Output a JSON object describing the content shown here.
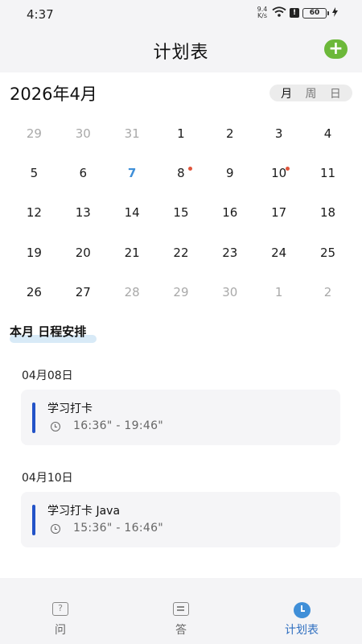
{
  "status_bar": {
    "time": "4:37",
    "net_speed_value": "9.4",
    "net_speed_unit": "K/s",
    "battery": "60"
  },
  "header": {
    "title": "计划表",
    "add_icon": "plus-circle-icon"
  },
  "calendar": {
    "month_title": "2026年4月",
    "view_options": [
      "月",
      "周",
      "日"
    ],
    "selected_view": "月",
    "today_day": "7",
    "event_marker_days": [
      "8",
      "10"
    ],
    "weeks": [
      [
        {
          "d": "29",
          "m": true
        },
        {
          "d": "30",
          "m": true
        },
        {
          "d": "31",
          "m": true
        },
        {
          "d": "1"
        },
        {
          "d": "2"
        },
        {
          "d": "3"
        },
        {
          "d": "4"
        }
      ],
      [
        {
          "d": "5"
        },
        {
          "d": "6"
        },
        {
          "d": "7",
          "today": true
        },
        {
          "d": "8",
          "dot": true
        },
        {
          "d": "9"
        },
        {
          "d": "10",
          "dot": true
        },
        {
          "d": "11"
        }
      ],
      [
        {
          "d": "12"
        },
        {
          "d": "13"
        },
        {
          "d": "14"
        },
        {
          "d": "15"
        },
        {
          "d": "16"
        },
        {
          "d": "17"
        },
        {
          "d": "18"
        }
      ],
      [
        {
          "d": "19"
        },
        {
          "d": "20"
        },
        {
          "d": "21"
        },
        {
          "d": "22"
        },
        {
          "d": "23"
        },
        {
          "d": "24"
        },
        {
          "d": "25"
        }
      ],
      [
        {
          "d": "26"
        },
        {
          "d": "27"
        },
        {
          "d": "28",
          "m": true
        },
        {
          "d": "29",
          "m": true
        },
        {
          "d": "30",
          "m": true
        },
        {
          "d": "1",
          "m": true
        },
        {
          "d": "2",
          "m": true
        }
      ]
    ]
  },
  "schedule": {
    "section_title": "本月 日程安排",
    "groups": [
      {
        "date": "04月08日",
        "events": [
          {
            "title": "学习打卡",
            "time": "16:36\" - 19:46\""
          }
        ]
      },
      {
        "date": "04月10日",
        "events": [
          {
            "title": "学习打卡 Java",
            "time": "15:36\" - 16:46\""
          }
        ]
      }
    ]
  },
  "tabbar": {
    "tabs": [
      {
        "label": "问",
        "icon": "question-icon",
        "icon_glyph": "?"
      },
      {
        "label": "答",
        "icon": "list-icon"
      },
      {
        "label": "计划表",
        "icon": "clock-icon"
      }
    ],
    "active_tab": "计划表"
  },
  "colors": {
    "accent_blue": "#3f8fd8",
    "add_green": "#6cb83a",
    "event_bar": "#2353c8",
    "marker_red": "#e0553c"
  }
}
